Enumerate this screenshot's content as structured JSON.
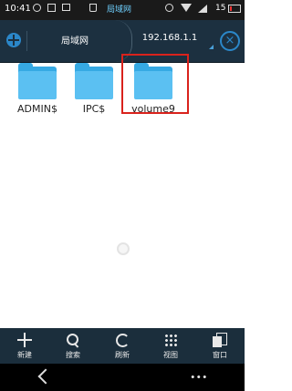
{
  "status_bar": {
    "time": "10:41",
    "center_label": "局域网",
    "battery_level": "15"
  },
  "nav": {
    "crumb_local": "局域网",
    "crumb_ip": "192.168.1.1",
    "close_symbol": "×"
  },
  "folders": [
    {
      "name": "ADMIN$"
    },
    {
      "name": "IPC$"
    },
    {
      "name": "volume9"
    }
  ],
  "toolbar": {
    "items": [
      {
        "label": "新建",
        "icon": "plus-icon"
      },
      {
        "label": "搜索",
        "icon": "search-icon"
      },
      {
        "label": "刷新",
        "icon": "refresh-icon"
      },
      {
        "label": "视图",
        "icon": "grid-view-icon"
      },
      {
        "label": "窗口",
        "icon": "window-icon"
      }
    ]
  },
  "colors": {
    "nav_bg": "#1c3040",
    "accent": "#2b87c9",
    "folder": "#5bc0f2",
    "highlight": "#d9221c"
  }
}
